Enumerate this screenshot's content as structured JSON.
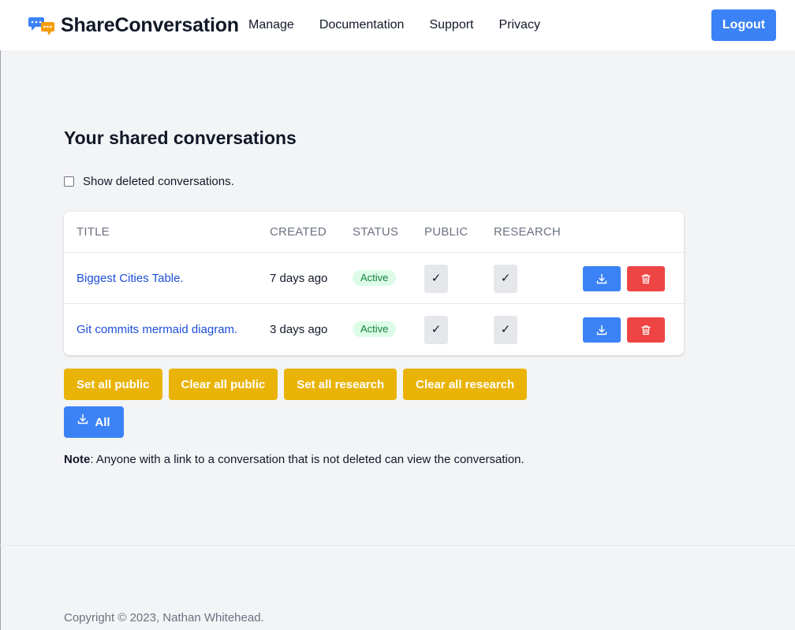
{
  "header": {
    "brand": "ShareConversation",
    "nav": [
      "Manage",
      "Documentation",
      "Support",
      "Privacy"
    ],
    "logout_label": "Logout"
  },
  "main": {
    "title": "Your shared conversations",
    "show_deleted_label": "Show deleted conversations.",
    "show_deleted_checked": false,
    "table": {
      "columns": [
        "TITLE",
        "CREATED",
        "STATUS",
        "PUBLIC",
        "RESEARCH"
      ],
      "rows": [
        {
          "title": "Biggest Cities Table.",
          "created": "7 days ago",
          "status": "Active",
          "public": "✓",
          "research": "✓"
        },
        {
          "title": "Git commits mermaid diagram.",
          "created": "3 days ago",
          "status": "Active",
          "public": "✓",
          "research": "✓"
        }
      ]
    },
    "actions": [
      "Set all public",
      "Clear all public",
      "Set all research",
      "Clear all research"
    ],
    "download_all_label": "All",
    "note_bold": "Note",
    "note_text": ": Anyone with a link to a conversation that is not deleted can view the conversation."
  },
  "footer": {
    "copyright": "Copyright © 2023, Nathan Whitehead."
  },
  "colors": {
    "primary": "#3b82f6",
    "danger": "#ef4444",
    "warning": "#eab308",
    "success_bg": "#dcfce7",
    "link": "#1d4ed8"
  }
}
